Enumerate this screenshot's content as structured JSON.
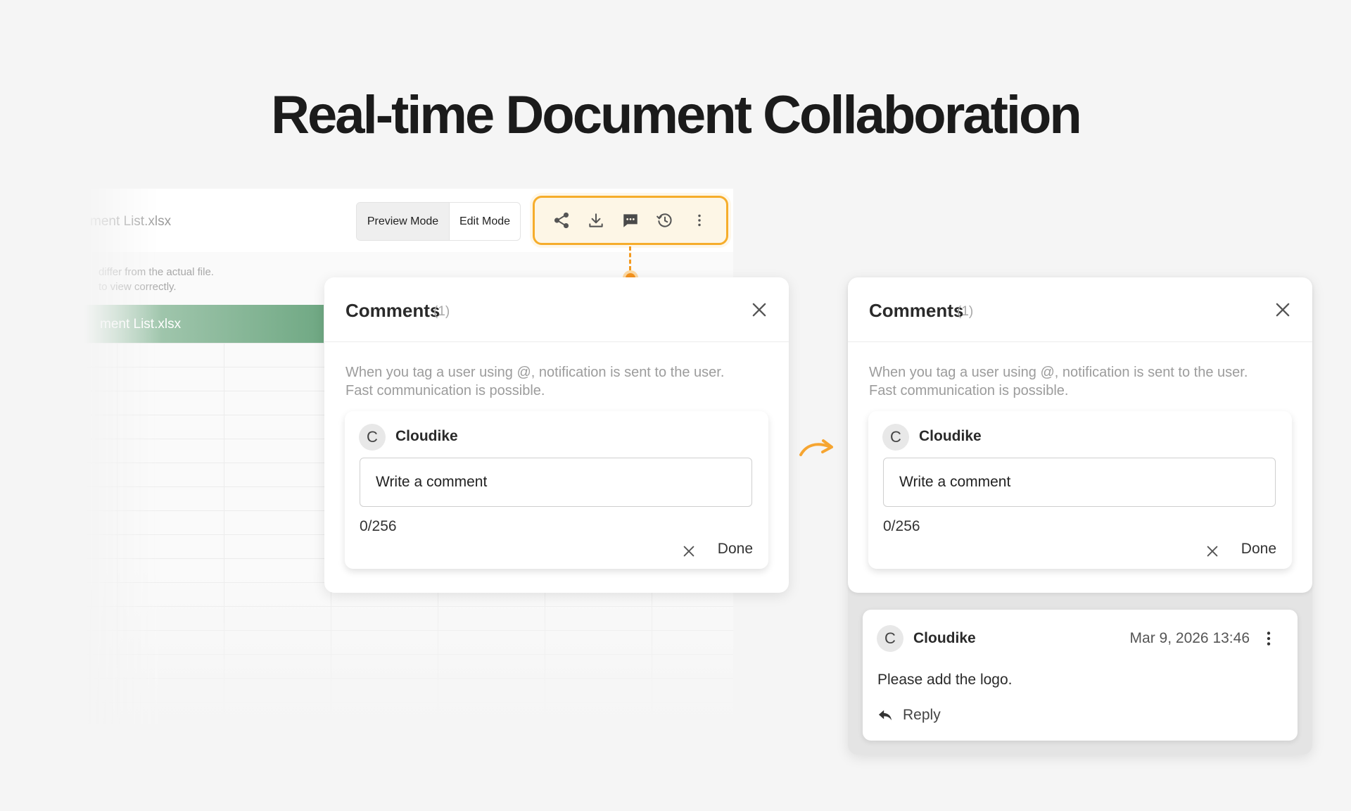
{
  "headline": "Real-time Document Collaboration",
  "doc": {
    "file_title": "ment List.xlsx",
    "mode_preview": "Preview Mode",
    "mode_edit": "Edit Mode",
    "notice_line1": "differ from the actual file.",
    "notice_line2": "to view correctly.",
    "sheet_name": "ment List.xlsx"
  },
  "toolbar": {
    "icons": [
      "share-icon",
      "download-icon",
      "comment-icon",
      "history-icon",
      "more-vertical-icon"
    ],
    "highlight_color": "#f6ad2b"
  },
  "comments_panel": {
    "title": "Comments",
    "count": "(1)",
    "hint_line1": "When you tag a user using @, notification is sent to the user.",
    "hint_line2": "Fast communication is possible.",
    "avatar_letter": "C",
    "user": "Cloudike",
    "input_placeholder": "Write a comment",
    "char_count": "0/256",
    "done_label": "Done"
  },
  "posted_comment": {
    "avatar_letter": "C",
    "user": "Cloudike",
    "date": "Mar 9, 2026 13:46",
    "text": "Please add the logo.",
    "reply_label": "Reply"
  },
  "colors": {
    "accent_orange": "#f6931d",
    "sheet_green": "#6fa883"
  }
}
